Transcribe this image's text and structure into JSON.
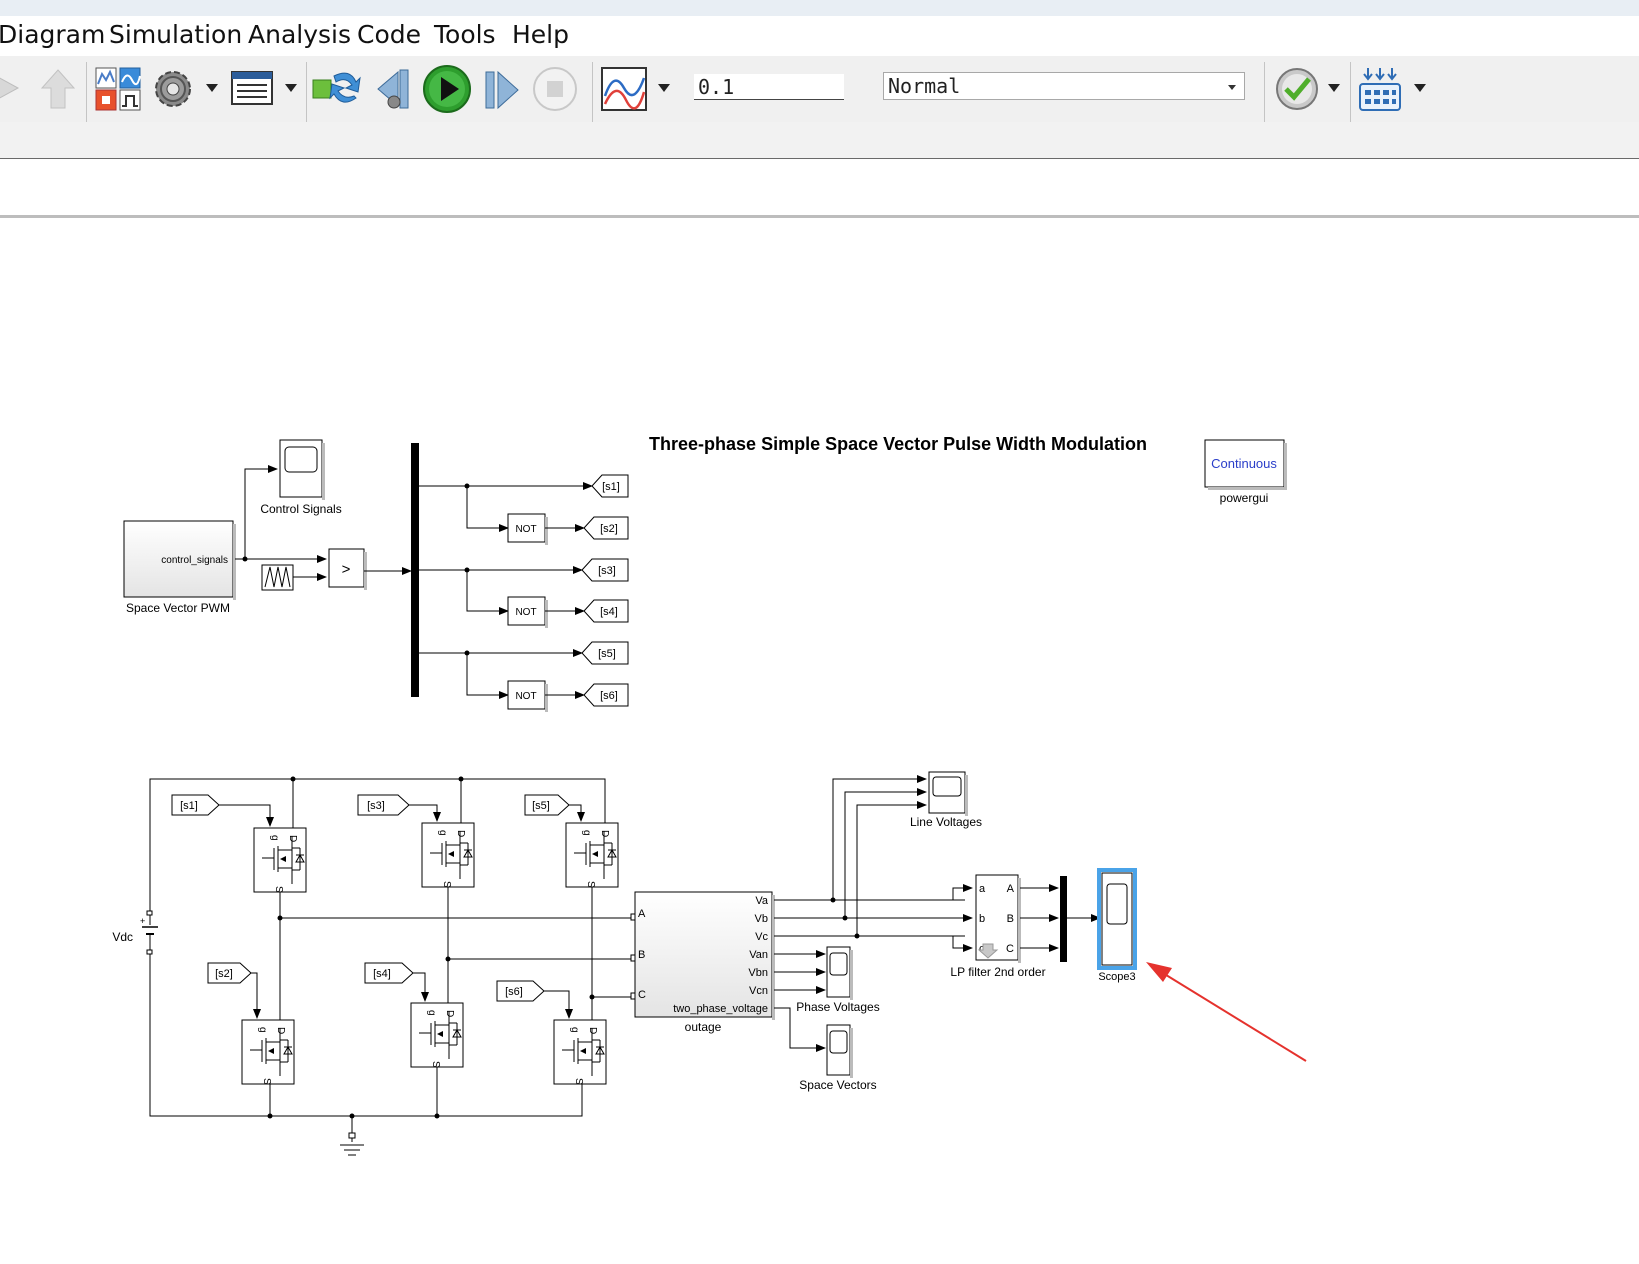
{
  "menu": {
    "diagram": "Diagram",
    "simulation": "Simulation",
    "analysis": "Analysis",
    "code": "Code",
    "tools": "Tools",
    "help": "Help"
  },
  "toolbar": {
    "stop_time": "0.1",
    "sim_mode": "Normal",
    "icons": [
      "forward-arrow-icon",
      "up-arrow-icon",
      "library-browser-icon",
      "model-settings-icon",
      "model-explorer-icon",
      "update-diagram-icon",
      "step-back-icon",
      "run-icon",
      "step-forward-icon",
      "stop-icon",
      "data-inspector-icon",
      "model-advisor-icon",
      "build-icon"
    ],
    "accent_run": "#2e9e2e"
  },
  "model": {
    "title": "Three-phase Simple Space Vector Pulse Width Modulation",
    "powergui": {
      "mode": "Continuous",
      "label": "powergui"
    },
    "pwm_block": {
      "port": "control_signals",
      "label": "Space Vector PWM"
    },
    "control_scope": "Control Signals",
    "relational_op": ">",
    "not_label": "NOT",
    "gotos": [
      "[s1]",
      "[s2]",
      "[s3]",
      "[s4]",
      "[s5]",
      "[s6]"
    ],
    "mosfet_pins": {
      "gate": "g",
      "drain": "D",
      "source": "S"
    },
    "dc_source": "Vdc",
    "measurement": {
      "inputs": [
        "A",
        "B",
        "C"
      ],
      "outputs": [
        "Va",
        "Vb",
        "Vc",
        "Van",
        "Vbn",
        "Vcn",
        "two_phase_voltage"
      ],
      "label": "outage"
    },
    "line_scope": "Line Voltages",
    "phase_scope": "Phase Voltages",
    "space_scope": "Space Vectors",
    "filter": {
      "inputs": [
        "a",
        "b",
        "c"
      ],
      "outputs": [
        "A",
        "B",
        "C"
      ],
      "label": "LP filter 2nd order"
    },
    "scope3": "Scope3",
    "highlight_color": "#4aa3e8",
    "arrow_color": "#e5322d"
  }
}
